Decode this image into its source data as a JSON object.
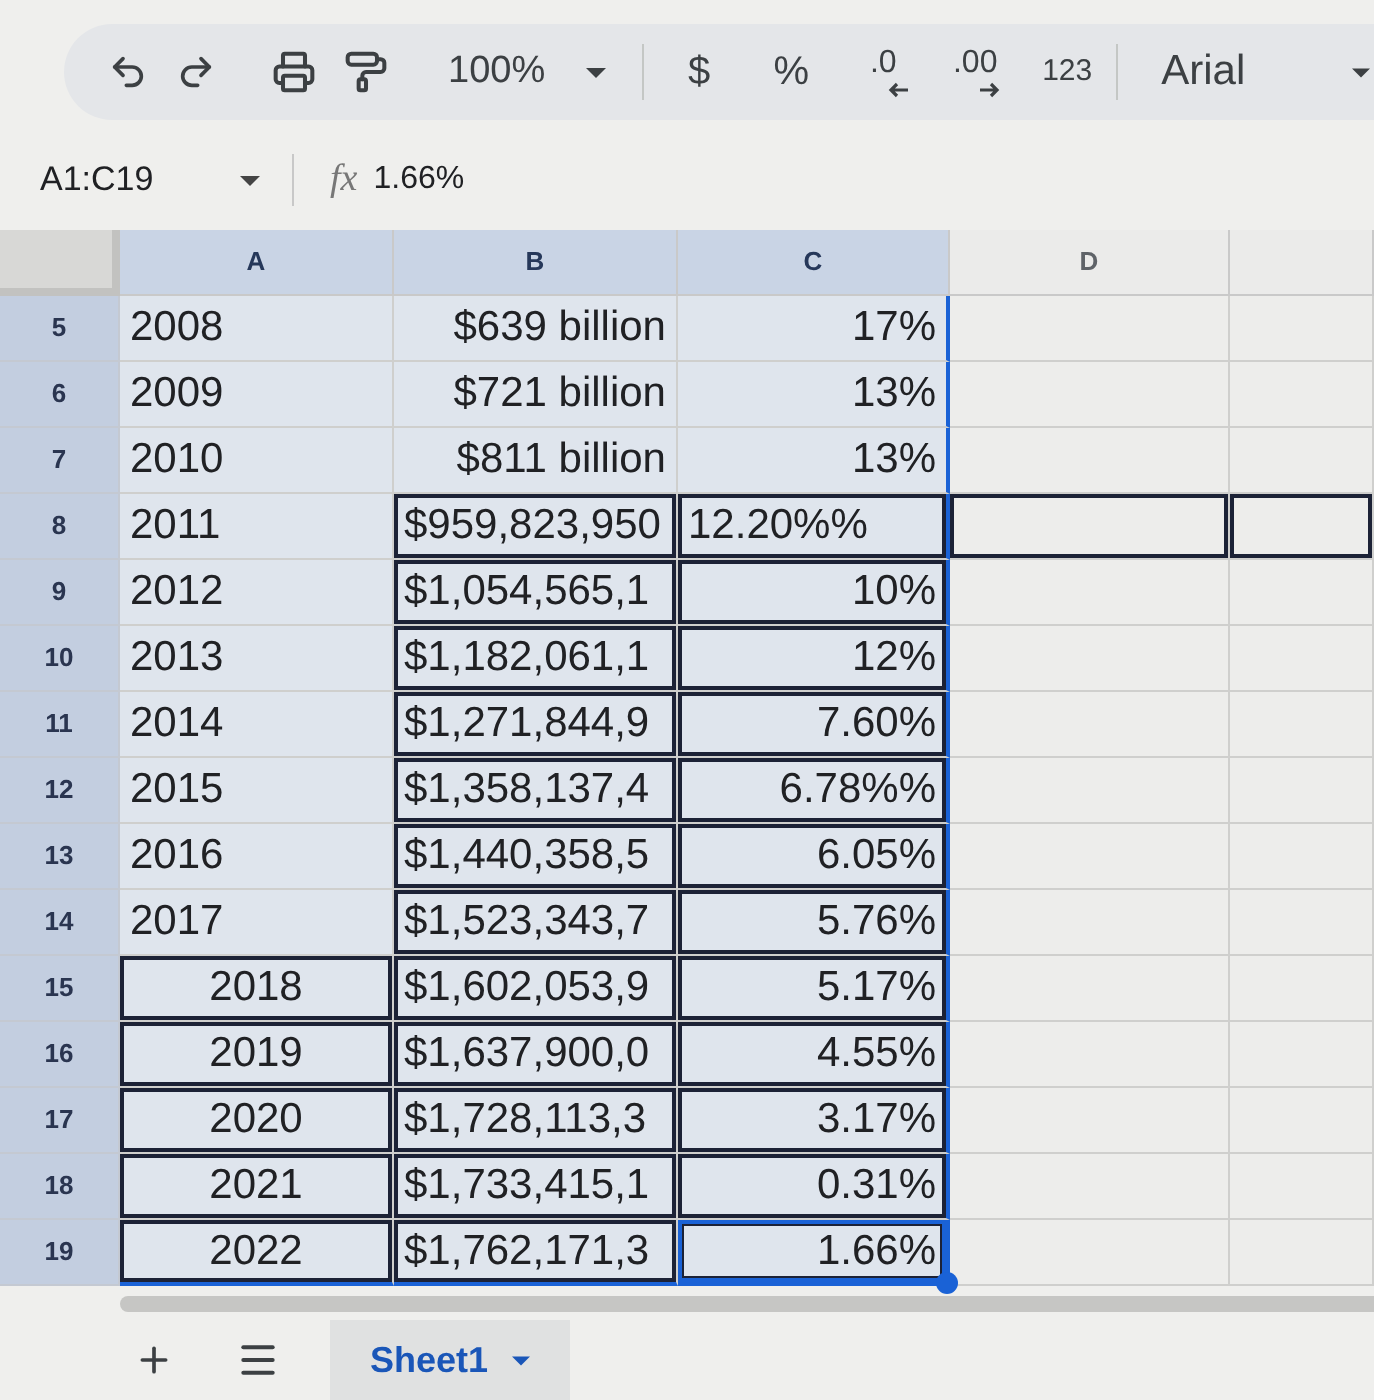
{
  "toolbar": {
    "zoom": "100%",
    "format_buttons": [
      {
        "kind": "currency",
        "label": "$"
      },
      {
        "kind": "percent",
        "label": "%"
      },
      {
        "kind": "decrease_decimal",
        "label": ".0"
      },
      {
        "kind": "increase_decimal",
        "label": ".00"
      },
      {
        "kind": "number_format",
        "label": "123"
      }
    ],
    "font": "Arial"
  },
  "formula_bar": {
    "name_box": "A1:C19",
    "function_symbol": "fx",
    "formula": "1.66%"
  },
  "columns": [
    {
      "label": "A",
      "selected": true
    },
    {
      "label": "B",
      "selected": true
    },
    {
      "label": "C",
      "selected": true
    },
    {
      "label": "D",
      "selected": false
    },
    {
      "selected": false
    }
  ],
  "rows": [
    {
      "number": "5",
      "selected": true,
      "cells": [
        {
          "kind": "left",
          "text": "2008",
          "bordered": false,
          "active": false
        },
        {
          "kind": "right",
          "text": "$639 billion",
          "bordered": false,
          "active": false
        },
        {
          "kind": "right",
          "text": "17%",
          "bordered": false,
          "active": false
        },
        {
          "kind": "empty",
          "bordered": false,
          "active": false
        },
        {
          "kind": "empty",
          "bordered": false,
          "active": false
        }
      ]
    },
    {
      "number": "6",
      "selected": true,
      "cells": [
        {
          "kind": "left",
          "text": "2009",
          "bordered": false,
          "active": false
        },
        {
          "kind": "right",
          "text": "$721 billion",
          "bordered": false,
          "active": false
        },
        {
          "kind": "right",
          "text": "13%",
          "bordered": false,
          "active": false
        },
        {
          "kind": "empty",
          "bordered": false,
          "active": false
        },
        {
          "kind": "empty",
          "bordered": false,
          "active": false
        }
      ]
    },
    {
      "number": "7",
      "selected": true,
      "cells": [
        {
          "kind": "left",
          "text": "2010",
          "bordered": false,
          "active": false
        },
        {
          "kind": "right",
          "text": "$811 billion",
          "bordered": false,
          "active": false
        },
        {
          "kind": "right",
          "text": "13%",
          "bordered": false,
          "active": false
        },
        {
          "kind": "empty",
          "bordered": false,
          "active": false
        },
        {
          "kind": "empty",
          "bordered": false,
          "active": false
        }
      ]
    },
    {
      "number": "8",
      "selected": true,
      "cells": [
        {
          "kind": "left",
          "text": "2011",
          "bordered": false,
          "active": false
        },
        {
          "kind": "left",
          "text": "$959,823,950",
          "bordered": true,
          "active": false
        },
        {
          "kind": "left",
          "text": "12.20%%",
          "bordered": true,
          "active": false
        },
        {
          "kind": "empty",
          "bordered": true,
          "active": false
        },
        {
          "kind": "empty",
          "bordered": true,
          "active": false
        }
      ]
    },
    {
      "number": "9",
      "selected": true,
      "cells": [
        {
          "kind": "left",
          "text": "2012",
          "bordered": false,
          "active": false
        },
        {
          "kind": "left",
          "text": "$1,054,565,1",
          "bordered": true,
          "active": false
        },
        {
          "kind": "right",
          "text": "10%",
          "bordered": true,
          "active": false
        },
        {
          "kind": "empty",
          "bordered": false,
          "active": false
        },
        {
          "kind": "empty",
          "bordered": false,
          "active": false
        }
      ]
    },
    {
      "number": "10",
      "selected": true,
      "cells": [
        {
          "kind": "left",
          "text": "2013",
          "bordered": false,
          "active": false
        },
        {
          "kind": "left",
          "text": "$1,182,061,1",
          "bordered": true,
          "active": false
        },
        {
          "kind": "right",
          "text": "12%",
          "bordered": true,
          "active": false
        },
        {
          "kind": "empty",
          "bordered": false,
          "active": false
        },
        {
          "kind": "empty",
          "bordered": false,
          "active": false
        }
      ]
    },
    {
      "number": "11",
      "selected": true,
      "cells": [
        {
          "kind": "left",
          "text": "2014",
          "bordered": false,
          "active": false
        },
        {
          "kind": "left",
          "text": "$1,271,844,9",
          "bordered": true,
          "active": false
        },
        {
          "kind": "right",
          "text": "7.60%",
          "bordered": true,
          "active": false
        },
        {
          "kind": "empty",
          "bordered": false,
          "active": false
        },
        {
          "kind": "empty",
          "bordered": false,
          "active": false
        }
      ]
    },
    {
      "number": "12",
      "selected": true,
      "cells": [
        {
          "kind": "left",
          "text": "2015",
          "bordered": false,
          "active": false
        },
        {
          "kind": "left",
          "text": "$1,358,137,4",
          "bordered": true,
          "active": false
        },
        {
          "kind": "right",
          "text": "6.78%%",
          "bordered": true,
          "active": false
        },
        {
          "kind": "empty",
          "bordered": false,
          "active": false
        },
        {
          "kind": "empty",
          "bordered": false,
          "active": false
        }
      ]
    },
    {
      "number": "13",
      "selected": true,
      "cells": [
        {
          "kind": "left",
          "text": "2016",
          "bordered": false,
          "active": false
        },
        {
          "kind": "left",
          "text": "$1,440,358,5",
          "bordered": true,
          "active": false
        },
        {
          "kind": "right",
          "text": "6.05%",
          "bordered": true,
          "active": false
        },
        {
          "kind": "empty",
          "bordered": false,
          "active": false
        },
        {
          "kind": "empty",
          "bordered": false,
          "active": false
        }
      ]
    },
    {
      "number": "14",
      "selected": true,
      "cells": [
        {
          "kind": "left",
          "text": "2017",
          "bordered": false,
          "active": false
        },
        {
          "kind": "left",
          "text": "$1,523,343,7",
          "bordered": true,
          "active": false
        },
        {
          "kind": "right",
          "text": "5.76%",
          "bordered": true,
          "active": false
        },
        {
          "kind": "empty",
          "bordered": false,
          "active": false
        },
        {
          "kind": "empty",
          "bordered": false,
          "active": false
        }
      ]
    },
    {
      "number": "15",
      "selected": true,
      "cells": [
        {
          "kind": "center",
          "text": "2018",
          "bordered": true,
          "active": false
        },
        {
          "kind": "left",
          "text": "$1,602,053,9",
          "bordered": true,
          "active": false
        },
        {
          "kind": "right",
          "text": "5.17%",
          "bordered": true,
          "active": false
        },
        {
          "kind": "empty",
          "bordered": false,
          "active": false
        },
        {
          "kind": "empty",
          "bordered": false,
          "active": false
        }
      ]
    },
    {
      "number": "16",
      "selected": true,
      "cells": [
        {
          "kind": "center",
          "text": "2019",
          "bordered": true,
          "active": false
        },
        {
          "kind": "left",
          "text": "$1,637,900,0",
          "bordered": true,
          "active": false
        },
        {
          "kind": "right",
          "text": "4.55%",
          "bordered": true,
          "active": false
        },
        {
          "kind": "empty",
          "bordered": false,
          "active": false
        },
        {
          "kind": "empty",
          "bordered": false,
          "active": false
        }
      ]
    },
    {
      "number": "17",
      "selected": true,
      "cells": [
        {
          "kind": "center",
          "text": "2020",
          "bordered": true,
          "active": false
        },
        {
          "kind": "left",
          "text": "$1,728,113,3",
          "bordered": true,
          "active": false
        },
        {
          "kind": "right",
          "text": "3.17%",
          "bordered": true,
          "active": false
        },
        {
          "kind": "empty",
          "bordered": false,
          "active": false
        },
        {
          "kind": "empty",
          "bordered": false,
          "active": false
        }
      ]
    },
    {
      "number": "18",
      "selected": true,
      "cells": [
        {
          "kind": "center",
          "text": "2021",
          "bordered": true,
          "active": false
        },
        {
          "kind": "left",
          "text": "$1,733,415,1",
          "bordered": true,
          "active": false
        },
        {
          "kind": "right",
          "text": "0.31%",
          "bordered": true,
          "active": false
        },
        {
          "kind": "empty",
          "bordered": false,
          "active": false
        },
        {
          "kind": "empty",
          "bordered": false,
          "active": false
        }
      ]
    },
    {
      "number": "19",
      "selected": true,
      "cells": [
        {
          "kind": "center",
          "text": "2022",
          "bordered": true,
          "active": false
        },
        {
          "kind": "left",
          "text": "$1,762,171,3",
          "bordered": true,
          "active": false
        },
        {
          "kind": "right",
          "text": "1.66%",
          "bordered": true,
          "active": true
        },
        {
          "kind": "empty",
          "bordered": false,
          "active": false
        },
        {
          "kind": "empty",
          "bordered": false,
          "active": false
        }
      ]
    }
  ],
  "sheets": [
    {
      "name": "Sheet1",
      "selected": true
    }
  ]
}
